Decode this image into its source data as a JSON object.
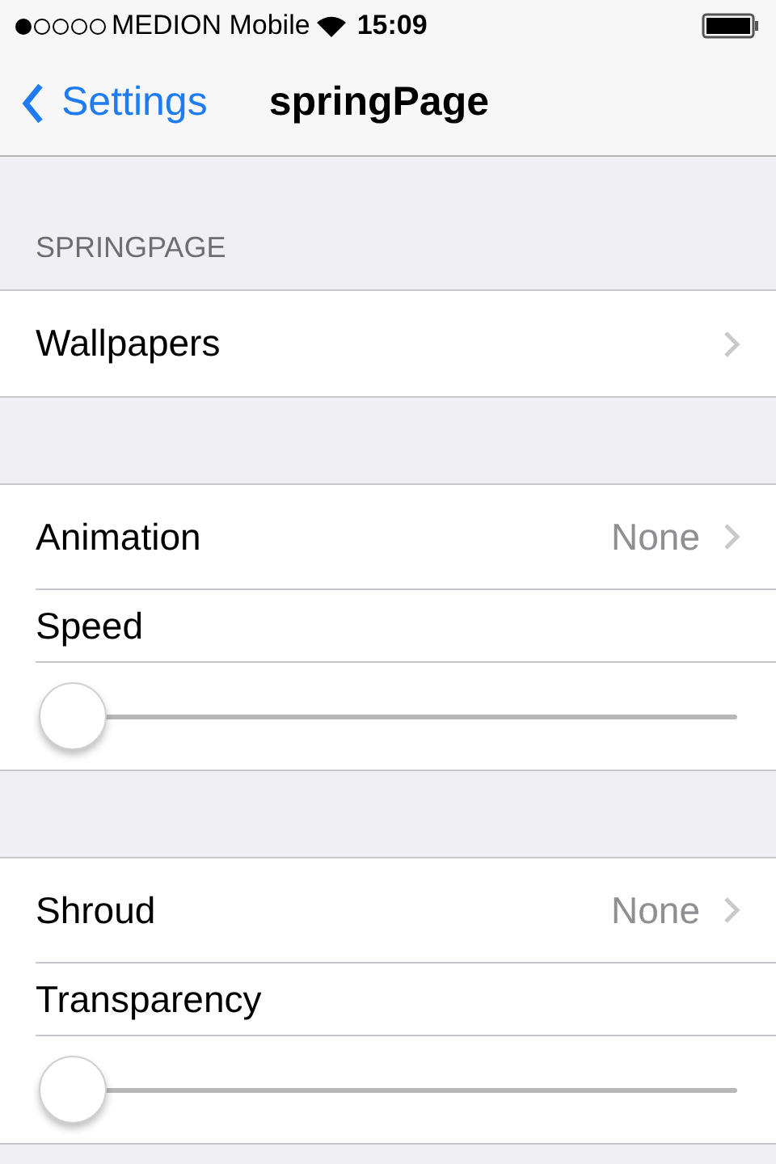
{
  "status_bar": {
    "carrier": "MEDION Mobile",
    "time": "15:09"
  },
  "nav": {
    "back": "Settings",
    "title": "springPage"
  },
  "sections": [
    {
      "header": "SPRINGPAGE",
      "rows": [
        {
          "kind": "link",
          "label": "Wallpapers"
        }
      ]
    },
    {
      "rows": [
        {
          "kind": "link",
          "label": "Animation",
          "value": "None"
        },
        {
          "kind": "label",
          "label": "Speed"
        },
        {
          "kind": "slider",
          "level": 0
        }
      ]
    },
    {
      "rows": [
        {
          "kind": "link",
          "label": "Shroud",
          "value": "None"
        },
        {
          "kind": "label",
          "label": "Transparency"
        },
        {
          "kind": "slider",
          "level": 0
        }
      ]
    }
  ]
}
